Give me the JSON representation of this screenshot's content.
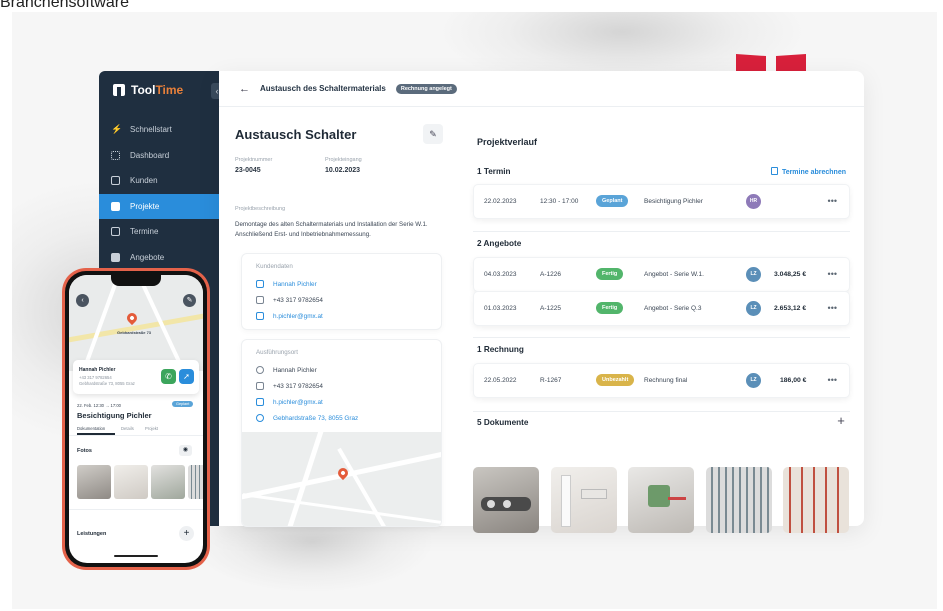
{
  "page_title": "Branchensoftware",
  "colors": {
    "sidebar_bg": "#1f2f40",
    "accent_blue": "#2a8ddb",
    "brand_orange": "#e8803a",
    "logo_red": "#d8203b",
    "status_geplant": "#5aa4d8",
    "status_fertig": "#52b56b",
    "status_unbezahlt": "#d9b44a"
  },
  "sidebar": {
    "brand_prefix": "Tool",
    "brand_suffix": "Time",
    "collapse_icon": "chevron-left-icon",
    "items": [
      {
        "label": "Schnellstart",
        "icon": "bolt-icon",
        "active": false
      },
      {
        "label": "Dashboard",
        "icon": "grid-icon",
        "active": false
      },
      {
        "label": "Kunden",
        "icon": "person-icon",
        "active": false
      },
      {
        "label": "Projekte",
        "icon": "folder-icon",
        "active": true
      },
      {
        "label": "Termine",
        "icon": "calendar-icon",
        "active": false
      },
      {
        "label": "Angebote",
        "icon": "document-icon",
        "active": false
      }
    ]
  },
  "topbar": {
    "title": "Austausch des Schaltermaterials",
    "badge": "Rechnung angelegt"
  },
  "project": {
    "title": "Austausch Schalter",
    "number_label": "Projektnummer",
    "number_value": "23-0045",
    "date_label": "Projekteingang",
    "date_value": "10.02.2023",
    "desc_label": "Projektbeschreibung",
    "description": "Demontage des alten Schaltermaterials und Installation der Serie W.1. Anschließend Erst- und Inbetriebnahmemessung.",
    "customer_label": "Kundendaten",
    "customer_name": "Hannah Pichler",
    "customer_phone": "+43 317 9782654",
    "customer_email": "h.pichler@gmx.at",
    "site_label": "Ausführungsort",
    "site_name": "Hannah Pichler",
    "site_phone": "+43 317 9782654",
    "site_email": "h.pichler@gmx.at",
    "site_address": "Gebhardstraße 73, 8055 Graz"
  },
  "history": {
    "title": "Projektverlauf",
    "termine": {
      "title": "1 Termin",
      "action": "Termine abrechnen",
      "rows": [
        {
          "date": "22.02.2023",
          "time": "12:30 - 17:00",
          "status": "Geplant",
          "desc": "Besichtigung Pichler",
          "avatar": "HR"
        }
      ]
    },
    "angebote": {
      "title": "2 Angebote",
      "rows": [
        {
          "date": "04.03.2023",
          "number": "A-1226",
          "status": "Fertig",
          "desc": "Angebot - Serie W.1.",
          "avatar": "LZ",
          "amount": "3.048,25 €"
        },
        {
          "date": "01.03.2023",
          "number": "A-1225",
          "status": "Fertig",
          "desc": "Angebot - Serie Q.3",
          "avatar": "LZ",
          "amount": "2.653,12 €"
        }
      ]
    },
    "rechnungen": {
      "title": "1 Rechnung",
      "rows": [
        {
          "date": "22.05.2022",
          "number": "R-1267",
          "status": "Unbezahlt",
          "desc": "Rechnung final",
          "avatar": "LZ",
          "amount": "186,00 €"
        }
      ]
    },
    "dokumente": {
      "title": "5 Dokumente"
    }
  },
  "phone": {
    "map_label": "Gebhardstraße 73",
    "contact_name": "Hannah Pichler",
    "contact_phone": "+43 317 9782654",
    "contact_address": "Gebhardstraße 73, 8055 Graz",
    "appt_time": "22. Feb. 12:30 → 17:00",
    "appt_badge": "Geplant",
    "appt_title": "Besichtigung Pichler",
    "tabs": [
      "Dokumentation",
      "Details",
      "Projekt"
    ],
    "photos_label": "Fotos",
    "services_label": "Leistungen"
  }
}
